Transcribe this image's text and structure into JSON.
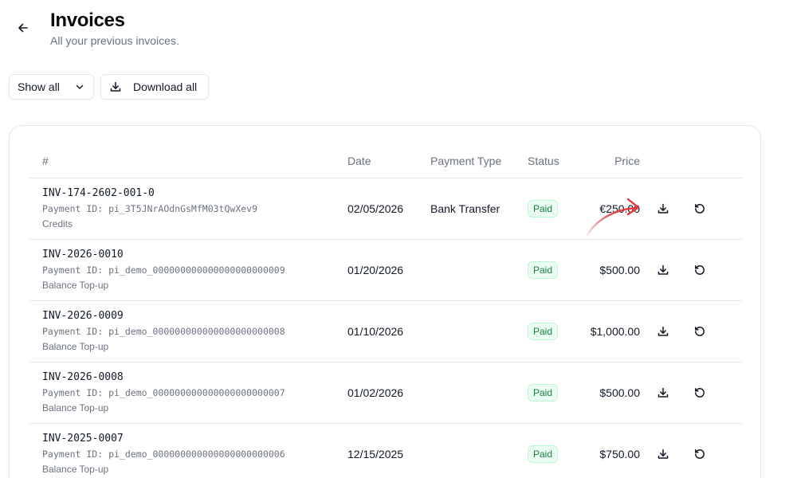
{
  "header": {
    "title": "Invoices",
    "subtitle": "All your previous invoices."
  },
  "toolbar": {
    "filter_label": "Show all",
    "download_all_label": "Download all"
  },
  "table": {
    "columns": [
      "#",
      "Date",
      "Payment Type",
      "Status",
      "Price"
    ],
    "rows": [
      {
        "invoice": "INV-174-2602-001-0",
        "payment_id": "Payment ID: pi_3T5JNrAOdnGsMfM03tQwXev9",
        "category": "Credits",
        "date": "02/05/2026",
        "payment_type": "Bank Transfer",
        "status": "Paid",
        "price": "€250.00"
      },
      {
        "invoice": "INV-2026-0010",
        "payment_id": "Payment ID: pi_demo_000000000000000000000009",
        "category": "Balance Top-up",
        "date": "01/20/2026",
        "payment_type": "",
        "status": "Paid",
        "price": "$500.00"
      },
      {
        "invoice": "INV-2026-0009",
        "payment_id": "Payment ID: pi_demo_000000000000000000000008",
        "category": "Balance Top-up",
        "date": "01/10/2026",
        "payment_type": "",
        "status": "Paid",
        "price": "$1,000.00"
      },
      {
        "invoice": "INV-2026-0008",
        "payment_id": "Payment ID: pi_demo_000000000000000000000007",
        "category": "Balance Top-up",
        "date": "01/02/2026",
        "payment_type": "",
        "status": "Paid",
        "price": "$500.00"
      },
      {
        "invoice": "INV-2025-0007",
        "payment_id": "Payment ID: pi_demo_000000000000000000000006",
        "category": "Balance Top-up",
        "date": "12/15/2025",
        "payment_type": "",
        "status": "Paid",
        "price": "$750.00"
      }
    ]
  },
  "icons": {
    "back": "arrow-left-icon",
    "filter": "chevron-down-icon",
    "download_all": "download-icon",
    "row_download": "download-icon",
    "row_refund": "rotate-ccw-icon"
  },
  "colors": {
    "badge_text": "#15803d",
    "badge_bg": "#ecfdf3",
    "annotation_arrow": "#e0393e"
  }
}
